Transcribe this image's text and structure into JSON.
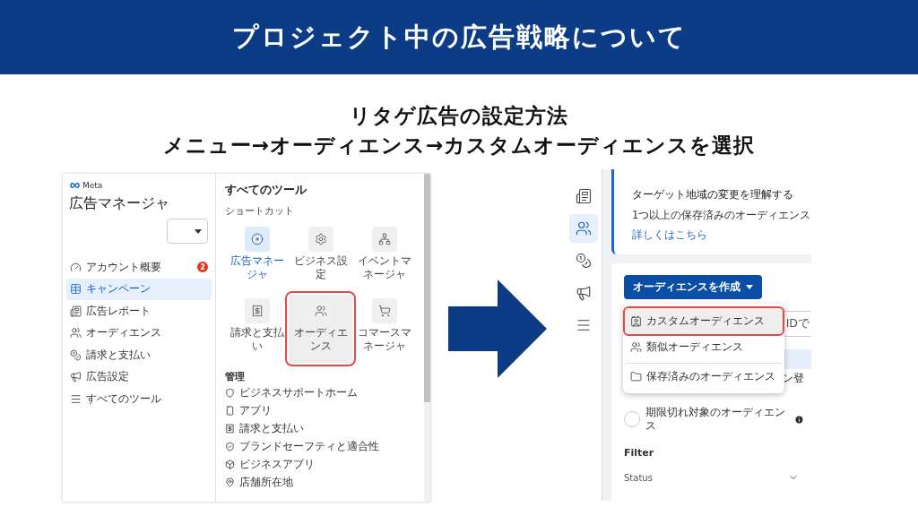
{
  "header": {
    "title": "プロジェクト中の広告戦略について"
  },
  "subtitle": [
    "リタゲ広告の設定方法",
    "メニュー→オーディエンス→カスタムオーディエンスを選択"
  ],
  "left_screen": {
    "brand": "Meta",
    "app_title": "広告マネージャ",
    "nav": [
      {
        "label": "アカウント概要",
        "selected": false,
        "badge": "2"
      },
      {
        "label": "キャンペーン",
        "selected": true
      },
      {
        "label": "広告レポート",
        "selected": false
      },
      {
        "label": "オーディエンス",
        "selected": false
      },
      {
        "label": "請求と支払い",
        "selected": false
      },
      {
        "label": "広告設定",
        "selected": false
      },
      {
        "label": "すべてのツール",
        "selected": false
      }
    ],
    "tools": {
      "title": "すべてのツール",
      "shortcuts_heading": "ショートカット",
      "shortcuts": [
        {
          "label": "広告マネージャ",
          "selected": true,
          "highlighted": false
        },
        {
          "label": "ビジネス設定",
          "selected": false,
          "highlighted": false
        },
        {
          "label": "イベントマネージャ",
          "selected": false,
          "highlighted": false
        },
        {
          "label": "請求と支払い",
          "selected": false,
          "highlighted": false
        },
        {
          "label": "オーディエンス",
          "selected": false,
          "highlighted": true
        },
        {
          "label": "コマースマネージャ",
          "selected": false,
          "highlighted": false
        }
      ],
      "manage_heading": "管理",
      "manage_items": [
        "ビジネスサポートホーム",
        "アプリ",
        "請求と支払い",
        "ブランドセーフティと適合性",
        "ビジネスアプリ",
        "店舗所在地"
      ]
    }
  },
  "right_screen": {
    "rail": [
      {
        "selected": false
      },
      {
        "selected": true
      },
      {
        "selected": false
      },
      {
        "selected": false
      },
      {
        "selected": false
      }
    ],
    "notice": {
      "title": "ターゲット地域の変更を理解する",
      "body": "1つ以上の保存済みのオーディエンス",
      "link": "詳しくはこちら"
    },
    "create_button": "オーディエンスを作成",
    "menu": [
      {
        "label": "カスタムオーディエンス",
        "highlighted": true,
        "separated": false
      },
      {
        "label": "類似オーディエンス",
        "highlighted": false,
        "separated": false
      },
      {
        "label": "保存済みのオーディエンス",
        "highlighted": false,
        "separated": true
      }
    ],
    "search": {
      "value": "IDで"
    },
    "covered_option": "ン登",
    "options": [
      {
        "label": "期限切れ対象のオーディエンス",
        "selected": false
      }
    ],
    "filter": {
      "heading": "Filter",
      "fields": [
        "Status"
      ]
    }
  }
}
